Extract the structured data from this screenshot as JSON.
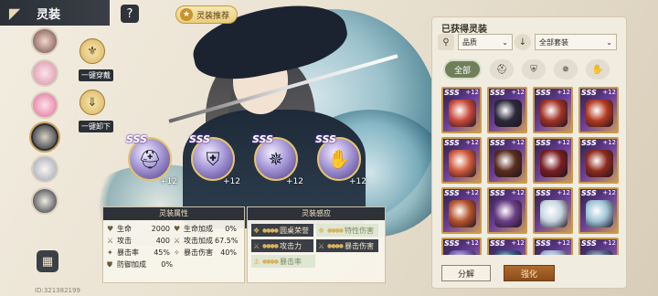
{
  "header": {
    "title": "灵装",
    "back_icon": "back-arrow-icon",
    "help_icon": "question-icon",
    "recommend_label": "灵装推荐"
  },
  "side": {
    "onekey_equip": "一键穿戴",
    "onekey_unequip": "一键卸下",
    "grid_icon": "grid-menu-icon",
    "player_id": "ID:321382199",
    "avatars": [
      "character-1",
      "character-2",
      "character-3",
      "character-4",
      "character-5",
      "character-6"
    ]
  },
  "equipped": [
    {
      "rank": "SSS",
      "level": "+12",
      "icon": "helmet-icon"
    },
    {
      "rank": "SSS",
      "level": "+12",
      "icon": "armor-icon"
    },
    {
      "rank": "SSS",
      "level": "+12",
      "icon": "compass-icon"
    },
    {
      "rank": "SSS",
      "level": "+12",
      "icon": "gauntlet-icon"
    }
  ],
  "stats": {
    "header": "灵装属性",
    "rows": [
      [
        {
          "name": "生命",
          "value": "2000"
        },
        {
          "name": "生命加成",
          "value": "0%"
        }
      ],
      [
        {
          "name": "攻击",
          "value": "400"
        },
        {
          "name": "攻击加成",
          "value": "67.5%"
        }
      ],
      [
        {
          "name": "暴击率",
          "value": "45%"
        },
        {
          "name": "暴击伤害",
          "value": "40%"
        }
      ],
      [
        {
          "name": "防御加成",
          "value": "0%"
        }
      ]
    ]
  },
  "resonance": {
    "header": "灵装感应",
    "rows": [
      [
        {
          "label": "圆桌荣誉",
          "dark": true
        },
        {
          "label": "特性伤害",
          "dark": false
        }
      ],
      [
        {
          "label": "攻击力",
          "dark": true
        },
        {
          "label": "暴击伤害",
          "dark": true
        }
      ],
      [
        {
          "label": "暴击率",
          "dark": false
        }
      ]
    ]
  },
  "inventory": {
    "title": "已获得灵装",
    "filter_quality": "品质",
    "filter_set": "全部套装",
    "categories": [
      "全部",
      "helmet-category-icon",
      "armor-category-icon",
      "accessory-category-icon",
      "glove-category-icon"
    ],
    "items": [
      {
        "rank": "SSS",
        "level": "+12",
        "color": "#c94a3a"
      },
      {
        "rank": "SSS",
        "level": "+12",
        "color": "#2c2a3a"
      },
      {
        "rank": "SSS",
        "level": "+12",
        "color": "#a23225"
      },
      {
        "rank": "SSS",
        "level": "+12",
        "color": "#b43a20"
      },
      {
        "rank": "SSS",
        "level": "+12",
        "color": "#d05a3a"
      },
      {
        "rank": "SSS",
        "level": "+12",
        "color": "#5a2d1d"
      },
      {
        "rank": "SSS",
        "level": "+12",
        "color": "#7a1e22"
      },
      {
        "rank": "SSS",
        "level": "+12",
        "color": "#8e2a1c"
      },
      {
        "rank": "SSS",
        "level": "+12",
        "color": "#b6542c"
      },
      {
        "rank": "SSS",
        "level": "+12",
        "color": "#6b3f86"
      },
      {
        "rank": "SSS",
        "level": "+12",
        "color": "#c7d6e0"
      },
      {
        "rank": "SSS",
        "level": "+12",
        "color": "#9fc3d6"
      },
      {
        "rank": "SSS",
        "level": "+12",
        "color": "#7e6ab8"
      },
      {
        "rank": "SSS",
        "level": "+12",
        "color": "#3e5a86"
      },
      {
        "rank": "SSS",
        "level": "+12",
        "color": "#a5b7d4"
      },
      {
        "rank": "SSS",
        "level": "+12",
        "color": "#5a6b8a"
      }
    ],
    "decompose": "分解",
    "enhance": "强化"
  }
}
